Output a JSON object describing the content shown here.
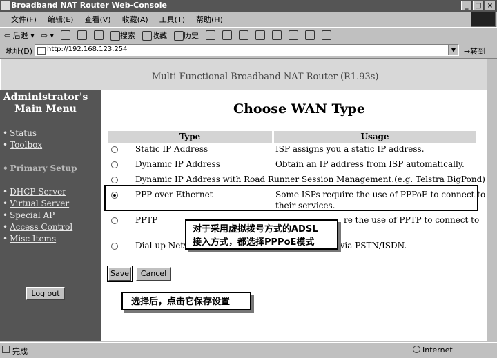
{
  "window": {
    "title": "Broadband NAT Router Web-Console"
  },
  "menu": [
    "文件(F)",
    "编辑(E)",
    "查看(V)",
    "收藏(A)",
    "工具(T)",
    "帮助(H)"
  ],
  "toolbar": {
    "back": "后退",
    "search": "搜索",
    "favorites": "收藏",
    "history": "历史"
  },
  "address": {
    "label": "地址(D)",
    "url": "http://192.168.123.254",
    "go": "转到"
  },
  "header": {
    "title": "Multi-Functional Broadband NAT Router (R1.93s)"
  },
  "sidebar": {
    "heading_line1": "Administrator's",
    "heading_line2": "Main Menu",
    "items": [
      "Status",
      "Toolbox",
      "Primary Setup",
      "DHCP Server",
      "Virtual Server",
      "Special AP",
      "Access Control",
      "Misc Items"
    ],
    "logout": "Log out"
  },
  "main": {
    "title": "Choose WAN Type",
    "col_type": "Type",
    "col_usage": "Usage",
    "rows": [
      {
        "type": "Static IP Address",
        "usage": "ISP assigns you a static IP address."
      },
      {
        "type": "Dynamic IP Address",
        "usage": "Obtain an IP address from ISP automatically."
      },
      {
        "type": "Dynamic IP Address with Road Runner Session Management.(e.g. Telstra BigPond)",
        "usage": ""
      },
      {
        "type": "PPP over Ethernet",
        "usage": "Some ISPs require the use of PPPoE to connect to",
        "usage2": "their services."
      },
      {
        "type": "PPTP",
        "usage": "re the use of PPTP to connect to"
      },
      {
        "type": "Dial-up Netw",
        "usage": "t via PSTN/ISDN."
      }
    ],
    "selected_index": 3,
    "save": "Save",
    "cancel": "Cancel"
  },
  "callouts": {
    "pppoe_line1": "对于采用虚拟拨号方式的ADSL",
    "pppoe_line2": "接入方式，都选择PPPoE模式",
    "save": "选择后，点击它保存设置"
  },
  "status": {
    "left": "完成",
    "zone": "Internet"
  }
}
